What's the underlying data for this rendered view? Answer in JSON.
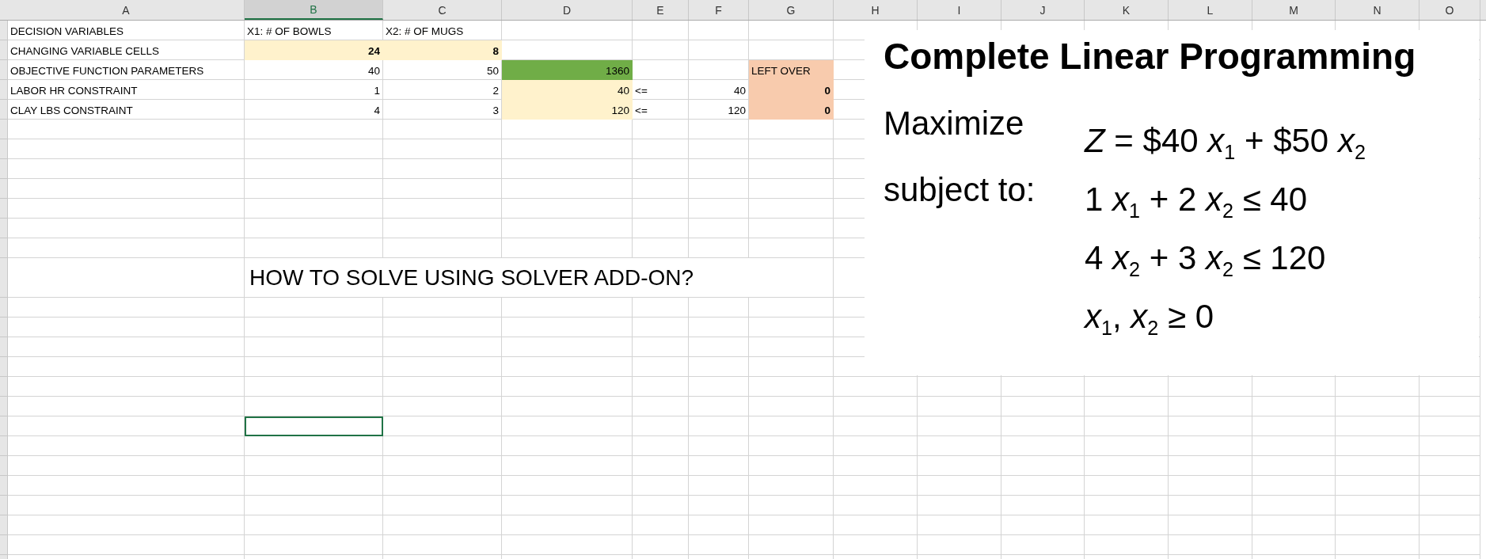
{
  "columns": [
    {
      "label": "A",
      "selected": false
    },
    {
      "label": "B",
      "selected": true
    },
    {
      "label": "C",
      "selected": false
    },
    {
      "label": "D",
      "selected": false
    },
    {
      "label": "E",
      "selected": false
    },
    {
      "label": "F",
      "selected": false
    },
    {
      "label": "G",
      "selected": false
    },
    {
      "label": "H",
      "selected": false
    },
    {
      "label": "I",
      "selected": false
    },
    {
      "label": "J",
      "selected": false
    },
    {
      "label": "K",
      "selected": false
    },
    {
      "label": "L",
      "selected": false
    },
    {
      "label": "M",
      "selected": false
    },
    {
      "label": "N",
      "selected": false
    },
    {
      "label": "O",
      "selected": false
    }
  ],
  "rows": [
    {
      "A": {
        "text": "DECISION VARIABLES",
        "kind": "text"
      },
      "B": {
        "text": "X1: # OF BOWLS",
        "kind": "text"
      },
      "C": {
        "text": "X2: # OF MUGS",
        "kind": "text"
      }
    },
    {
      "A": {
        "text": "CHANGING VARIABLE CELLS",
        "kind": "text"
      },
      "B": {
        "text": "24",
        "kind": "number",
        "bold": true,
        "color": "#fff2cc"
      },
      "C": {
        "text": "8",
        "kind": "number",
        "bold": true,
        "color": "#fff2cc"
      }
    },
    {
      "A": {
        "text": "OBJECTIVE FUNCTION PARAMETERS",
        "kind": "text"
      },
      "B": {
        "text": "40",
        "kind": "number"
      },
      "C": {
        "text": "50",
        "kind": "number"
      },
      "D": {
        "text": "1360",
        "kind": "number",
        "color": "#70ad47"
      },
      "G": {
        "text": "LEFT OVER",
        "kind": "text",
        "color": "#f8cbad"
      }
    },
    {
      "A": {
        "text": "LABOR HR CONSTRAINT",
        "kind": "text"
      },
      "B": {
        "text": "1",
        "kind": "number"
      },
      "C": {
        "text": "2",
        "kind": "number"
      },
      "D": {
        "text": "40",
        "kind": "number",
        "color": "#fff2cc"
      },
      "E": {
        "text": "<=",
        "kind": "text"
      },
      "F": {
        "text": "40",
        "kind": "number"
      },
      "G": {
        "text": "0",
        "kind": "number",
        "bold": true,
        "color": "#f8cbad"
      }
    },
    {
      "A": {
        "text": "CLAY LBS CONSTRAINT",
        "kind": "text"
      },
      "B": {
        "text": "4",
        "kind": "number"
      },
      "C": {
        "text": "3",
        "kind": "number"
      },
      "D": {
        "text": "120",
        "kind": "number",
        "color": "#fff2cc"
      },
      "E": {
        "text": "<=",
        "kind": "text"
      },
      "F": {
        "text": "120",
        "kind": "number"
      },
      "G": {
        "text": "0",
        "kind": "number",
        "bold": true,
        "color": "#f8cbad"
      }
    }
  ],
  "note": "HOW TO SOLVE USING SOLVER ADD-ON?",
  "math_panel": {
    "title": "Complete Linear Programming",
    "objective_label": "Maximize",
    "objective": "*Z* = $40 *x*$_{1}$ + $50 *x*$_{2}$",
    "constraints_label": "subject to:",
    "constraints": [
      "1 *x*$_{1}$ + 2 *x*$_{2}$ ≤ 40",
      "4 *x*$_{2}$ + 3 *x*$_{2}$ ≤ 120",
      "*x*$_{1}$, *x*$_{2}$ ≥ 0"
    ]
  }
}
